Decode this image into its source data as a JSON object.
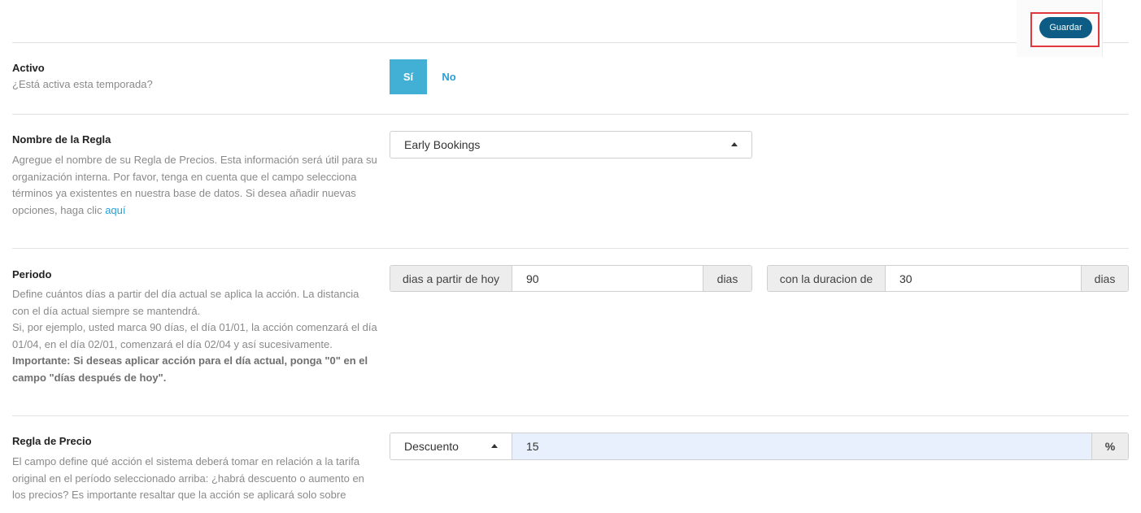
{
  "toolbar": {
    "save_label": "Guardar"
  },
  "activo": {
    "label": "Activo",
    "description": "¿Está activa esta temporada?",
    "yes_label": "Sí",
    "no_label": "No"
  },
  "nombre": {
    "label": "Nombre de la Regla",
    "description": "Agregue el nombre de su Regla de Precios. Esta información será útil para su organización interna. Por favor, tenga en cuenta que el campo selecciona términos ya existentes en nuestra base de datos. Si desea añadir nuevas opciones, haga clic ",
    "link_label": "aquí",
    "selected_value": "Early Bookings"
  },
  "periodo": {
    "label": "Periodo",
    "desc_line1": "Define cuántos días a partir del día actual se aplica la acción. La distancia con el día actual siempre se mantendrá.",
    "desc_line2": "Si, por ejemplo, usted marca 90 días, el día 01/01, la acción comenzará el día 01/04, en el día 02/01, comenzará el día 02/04 y así sucesivamente.",
    "desc_important": "Importante: Si deseas aplicar acción para el día actual, ponga \"0\" en el campo \"días después de hoy\".",
    "start_prefix": "dias a partir de hoy",
    "start_value": "90",
    "start_suffix": "dias",
    "duration_prefix": "con la duracion de",
    "duration_value": "30",
    "duration_suffix": "dias"
  },
  "regla_precio": {
    "label": "Regla de Precio",
    "description": "El campo define qué acción el sistema deberá tomar en relación a la tarifa original en el período seleccionado arriba: ¿habrá descuento o aumento en los precios? Es importante resaltar que la acción se aplicará solo sobre",
    "type_value": "Descuento",
    "amount_value": "15",
    "unit_label": "%"
  }
}
